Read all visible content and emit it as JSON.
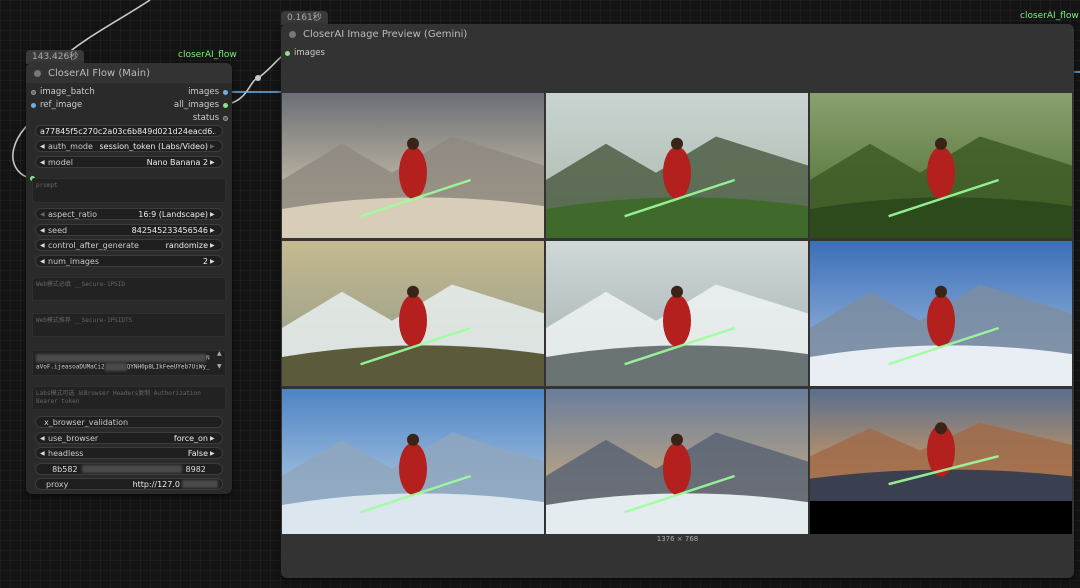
{
  "flow_node": {
    "timing": "143.426秒",
    "group_label": "closerAI_flow",
    "title": "CloserAI Flow (Main)",
    "inputs": [
      "image_batch",
      "ref_image"
    ],
    "outputs": [
      "images",
      "all_images",
      "status"
    ],
    "hash_field": "a77845f5c270c2a03c6b849d021d24eacd6...",
    "auth_mode": {
      "label": "auth_mode",
      "value": "session_token (Labs/Video)"
    },
    "model": {
      "label": "model",
      "value": "Nano Banana 2"
    },
    "prompt_placeholder": "prompt",
    "aspect_ratio": {
      "label": "aspect_ratio",
      "value": "16:9 (Landscape)"
    },
    "seed": {
      "label": "seed",
      "value": "842545233456546"
    },
    "control_after_generate": {
      "label": "control_after_generate",
      "value": "randomize"
    },
    "num_images": {
      "label": "num_images",
      "value": "2"
    },
    "web_psid_placeholder": "Web模式必填  __Secure-1PSID",
    "web_psidts_placeholder": "Web模式推荐  __Secure-1PSIDTS",
    "cookie_line_2": "aVoF.ijeasoaDUMaCi2",
    "cookie_line_2_tail": "QYNH0p8LIkFeeUYeb7UiWy_",
    "labs_placeholder": "Labs模式可选  从Browser Headers复制 Authorization Bearer token",
    "x_browser_validation": "x_browser_validation",
    "use_browser": {
      "label": "use_browser",
      "value": "force_on"
    },
    "headless": {
      "label": "headless",
      "value": "False"
    },
    "key_field_start": "8b582",
    "key_field_end": "8982",
    "proxy": {
      "label": "proxy",
      "value": "http://127.0"
    }
  },
  "preview_node": {
    "timing": "0.161秒",
    "group_label": "closerAI_flow",
    "title": "CloserAI Image Preview (Gemini)",
    "input": "images",
    "dimensions": "1376 × 768",
    "image_count": 9
  },
  "colors": {
    "accent_green": "#7cf07c",
    "slot_blue": "#6ab0e8",
    "slot_green": "#8de08d"
  }
}
